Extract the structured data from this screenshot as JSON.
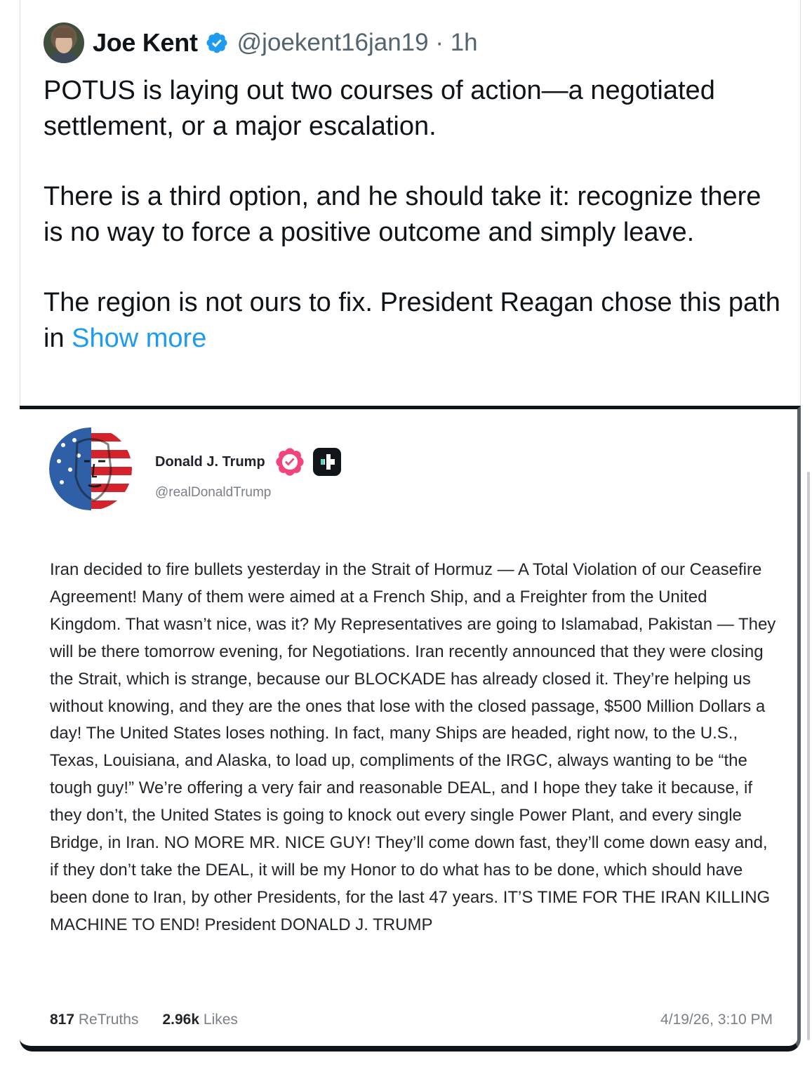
{
  "tweet": {
    "author_name": "Joe Kent",
    "handle_time": "@joekent16jan19 · 1h",
    "paragraphs": [
      "POTUS is laying out two courses of action—a negotiated settlement, or a major escalation.",
      "There is a third option, and he should take it: recognize there is no way to force a positive outcome and simply leave."
    ],
    "last_paragraph": "The region is not ours to fix. President Reagan chose this path in ",
    "show_more": "Show more",
    "verified_color": "#1d9bf0"
  },
  "embed": {
    "author_name": "Donald J. Trump",
    "handle": "@realDonaldTrump",
    "badge_color": "#f2447a",
    "body": "Iran decided to fire bullets yesterday in the Strait of Hormuz — A Total Violation of our Ceasefire Agreement! Many of them were aimed at a French Ship, and a Freighter from the United Kingdom. That wasn’t nice, was it? My Representatives are going to Islamabad, Pakistan — They will be there tomorrow evening, for Negotiations. Iran recently announced that they were closing the Strait, which is strange, because our BLOCKADE has already closed it. They’re helping us without knowing, and they are the ones that lose with the closed passage, $500 Million Dollars a day! The United States loses nothing. In fact, many Ships are headed, right now, to the U.S., Texas, Louisiana, and Alaska, to load up, compliments of the IRGC, always wanting to be “the tough guy!” We’re offering a very fair and reasonable DEAL, and I hope they take it because, if they don’t, the United States is going to knock out every single Power Plant, and every single Bridge, in Iran. NO MORE MR. NICE GUY! They’ll come down fast, they’ll come down easy and, if they don’t take the DEAL, it will be my Honor to do what has to be done, which should have been done to Iran, by other Presidents, for the last 47 years. IT’S TIME FOR THE IRAN KILLING MACHINE TO END! President DONALD J. TRUMP",
    "retruths_count": "817",
    "retruths_label": "ReTruths",
    "likes_count": "2.96k",
    "likes_label": "Likes",
    "timestamp": "4/19/26, 3:10 PM"
  }
}
